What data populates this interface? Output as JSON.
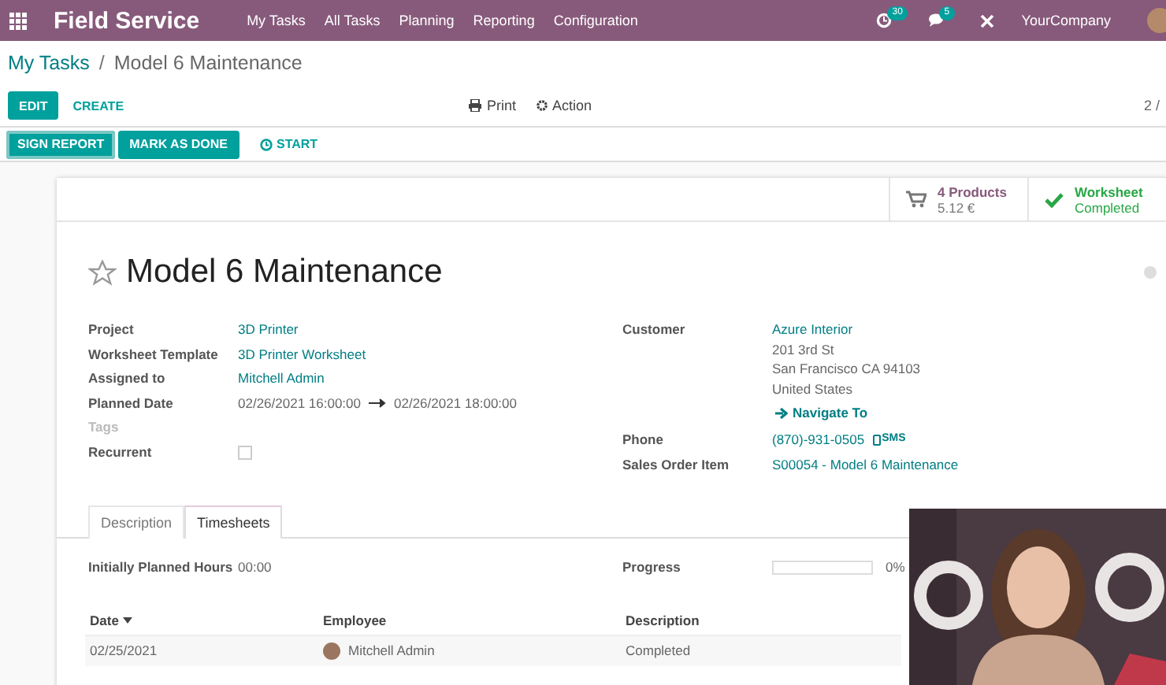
{
  "navbar": {
    "app_name": "Field Service",
    "menu": [
      "My Tasks",
      "All Tasks",
      "Planning",
      "Reporting",
      "Configuration"
    ],
    "activity_count": "30",
    "message_count": "5",
    "company": "YourCompany"
  },
  "breadcrumb": [
    {
      "label": "My Tasks",
      "kind": "link"
    },
    {
      "label": "Model 6 Maintenance",
      "kind": "current",
      "separator": "/"
    }
  ],
  "control_panel": {
    "buttons": [
      {
        "label": "EDIT",
        "kind": "primary"
      },
      {
        "label": "CREATE",
        "kind": "link"
      }
    ],
    "actions": [
      {
        "label": "Print",
        "kind": "print"
      },
      {
        "label": "Action",
        "kind": "gear"
      }
    ],
    "pager": "2 /"
  },
  "status_bar": {
    "buttons": [
      {
        "label": "SIGN REPORT",
        "kind": "primary",
        "selected": true
      },
      {
        "label": "MARK AS DONE",
        "kind": "primary",
        "selected": false
      },
      {
        "label": "START",
        "kind": "link",
        "selected": false
      }
    ]
  },
  "smart_buttons": [
    {
      "kind": "products",
      "title": "4 Products",
      "subtitle": "5.12 €"
    },
    {
      "kind": "worksheet",
      "title": "Worksheet",
      "subtitle": "Completed"
    }
  ],
  "title": {
    "text": "Model 6 Maintenance",
    "starred": false
  },
  "left_fields": [
    {
      "label": "Project",
      "kind": "link",
      "value": "3D Printer"
    },
    {
      "label": "Worksheet Template",
      "kind": "link",
      "value": "3D Printer Worksheet"
    },
    {
      "label": "Assigned to",
      "kind": "link",
      "value": "Mitchell Admin"
    },
    {
      "label": "Planned Date",
      "kind": "daterange",
      "value": "02/26/2021 16:00:00",
      "value_end": "02/26/2021 18:00:00"
    },
    {
      "label": "Tags",
      "kind": "empty"
    },
    {
      "label": "Recurrent",
      "kind": "checkbox",
      "checked": false
    }
  ],
  "right_fields": [
    {
      "label": "Customer",
      "kind": "address",
      "value": "Azure Interior",
      "lines": [
        "201 3rd St",
        "San Francisco CA 94103",
        "United States"
      ],
      "action": "Navigate To"
    },
    {
      "label": "Phone",
      "kind": "phone",
      "value": "(870)-931-0505",
      "action": "SMS"
    },
    {
      "label": "Sales Order Item",
      "kind": "link",
      "value": "S00054 - Model 6 Maintenance"
    }
  ],
  "notebook": {
    "tabs": [
      {
        "label": "Description",
        "selected": false
      },
      {
        "label": "Timesheets",
        "selected": true
      }
    ],
    "planned_hours": {
      "label": "Initially Planned Hours",
      "value": "00:00"
    },
    "progress": {
      "label": "Progress",
      "level": 0,
      "reading": "0%"
    },
    "table": {
      "columns": [
        {
          "label": "Date",
          "sorted": true
        },
        {
          "label": "Employee",
          "sorted": false
        },
        {
          "label": "Description",
          "sorted": false
        }
      ],
      "rows": [
        {
          "date": "02/25/2021",
          "employee": "Mitchell Admin",
          "description": "Completed"
        }
      ]
    }
  }
}
